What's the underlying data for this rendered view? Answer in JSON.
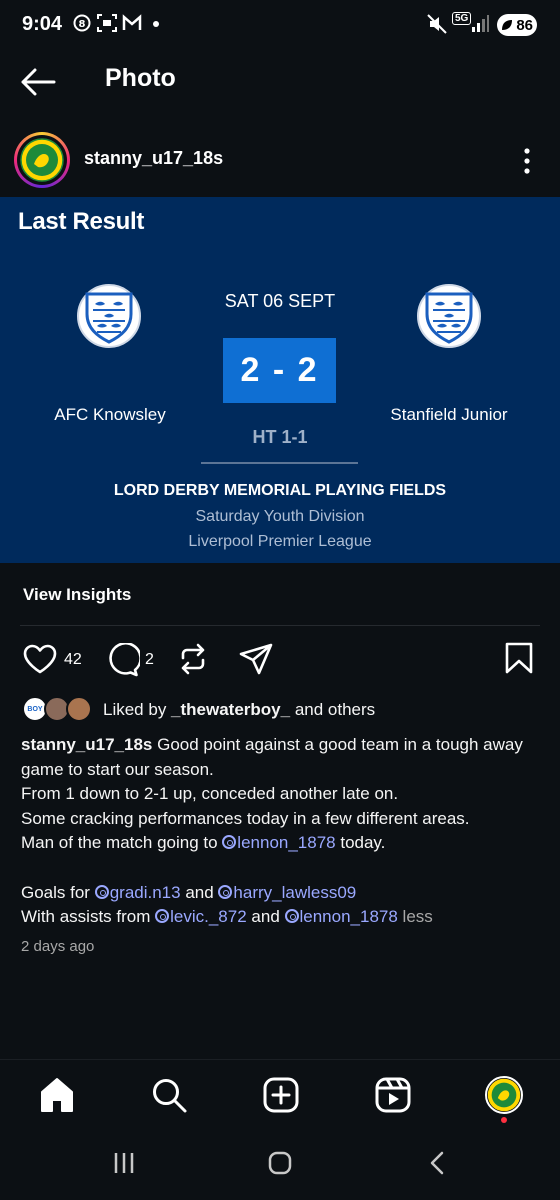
{
  "status_bar": {
    "time": "9:04",
    "network": "5G",
    "battery": "86"
  },
  "header": {
    "title": "Photo"
  },
  "post": {
    "username": "stanny_u17_18s",
    "image": {
      "heading": "Last Result",
      "date": "SAT 06 SEPT",
      "home_team": "AFC Knowsley",
      "away_team": "Stanfield Junior",
      "score": "2 - 2",
      "halftime": "HT 1-1",
      "venue": "LORD DERBY MEMORIAL PLAYING FIELDS",
      "division": "Saturday Youth Division",
      "league": "Liverpool Premier League"
    },
    "insights_label": "View Insights",
    "like_count": "42",
    "comment_count": "2",
    "liked_by_prefix": "Liked by ",
    "liked_by_user": "_thewaterboy_",
    "liked_by_suffix": " and others",
    "liker_badge_text": "BOY",
    "caption": {
      "username": "stanny_u17_18s",
      "line1": " Good point against a good team in a tough away game to start our season.",
      "line2": "From 1 down to 2-1 up, conceded another late on.",
      "line3": "Some cracking performances today in a few different areas.",
      "line4_prefix": "Man of the match going to ",
      "mention_motm": "lennon_1878",
      "line4_suffix": " today.",
      "line5_prefix": "Goals for ",
      "mention_goal1": "gradi.n13",
      "line5_and": " and ",
      "mention_goal2": "harry_lawless09",
      "line6_prefix": "With assists from ",
      "mention_assist1": "levic._872",
      "line6_and": " and ",
      "mention_assist2": "lennon_1878",
      "less": " less"
    },
    "time_ago": "2 days ago"
  },
  "bottom_nav": {
    "items": [
      "home-icon",
      "search-icon",
      "create-icon",
      "reels-icon",
      "profile-avatar"
    ]
  },
  "colors": {
    "background": "#0c1014",
    "card": "#002a5c",
    "score_box": "#0f6fd3",
    "mention": "#9aa8ff",
    "notification_dot": "#ff3040"
  }
}
